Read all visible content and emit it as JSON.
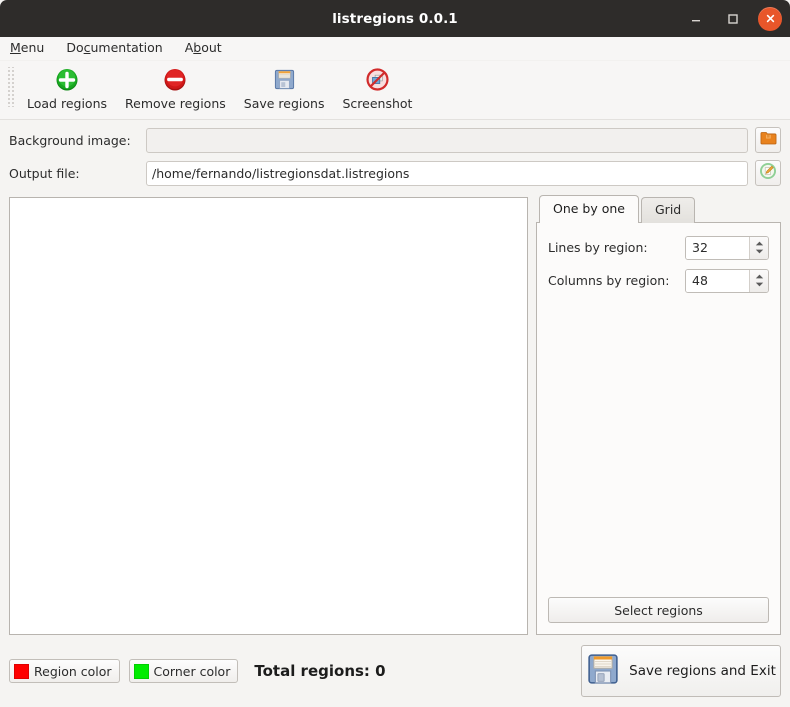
{
  "window": {
    "title": "listregions 0.0.1",
    "minimize_icon": "minimize-icon",
    "maximize_icon": "maximize-icon",
    "close_icon": "close-icon",
    "close_color": "#e8562a",
    "titlebar_color": "#2e2c2a"
  },
  "menubar": {
    "items": [
      {
        "label": "Menu",
        "mnemonic": "M",
        "rest": "enu"
      },
      {
        "label": "Documentation",
        "pre": "Do",
        "mnemonic": "c",
        "rest": "umentation"
      },
      {
        "label": "About",
        "pre": "A",
        "mnemonic": "b",
        "rest": "out"
      }
    ]
  },
  "toolbar": {
    "buttons": [
      {
        "label": "Load regions",
        "icon": "plus-circle-icon",
        "color": "#14a01a"
      },
      {
        "label": "Remove regions",
        "icon": "minus-circle-icon",
        "color": "#d81b1b"
      },
      {
        "label": "Save regions",
        "icon": "floppy-disk-icon",
        "color": "#7f9bc4"
      },
      {
        "label": "Screenshot",
        "icon": "screenshot-forbidden-icon",
        "color": "#d12b2b"
      }
    ]
  },
  "fields": {
    "background_image": {
      "label": "Background image:",
      "value": "",
      "placeholder": "",
      "browse_icon": "folder-icon",
      "browse_color": "#e8821e"
    },
    "output_file": {
      "label": "Output file:",
      "value": "/home/fernando/listregionsdat.listregions",
      "placeholder": "",
      "browse_icon": "edit-file-icon",
      "browse_color": "#79c47e"
    }
  },
  "canvas": {
    "background": "#ffffff"
  },
  "right_panel": {
    "tabs": [
      {
        "label": "One by one",
        "active": true
      },
      {
        "label": "Grid",
        "active": false
      }
    ],
    "one_by_one": {
      "lines": {
        "label": "Lines by region:",
        "value": "32"
      },
      "columns": {
        "label": "Columns by region:",
        "value": "48"
      }
    },
    "select_regions_label": "Select regions"
  },
  "bottom": {
    "region_color": {
      "label": "Region color",
      "color": "#fe0000"
    },
    "corner_color": {
      "label": "Corner color",
      "color": "#00ec00"
    },
    "total_regions": "Total regions: 0",
    "save_and_exit": {
      "label": "Save regions and Exit",
      "icon": "floppy-disk-icon"
    }
  }
}
